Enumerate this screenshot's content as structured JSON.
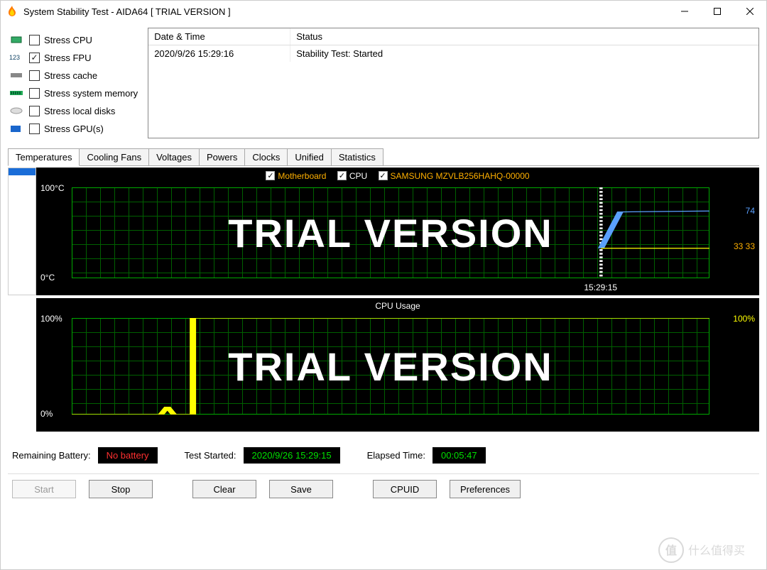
{
  "window": {
    "title": "System Stability Test - AIDA64  [ TRIAL VERSION ]"
  },
  "stress": {
    "cpu": {
      "label": "Stress CPU",
      "checked": false
    },
    "fpu": {
      "label": "Stress FPU",
      "checked": true
    },
    "cache": {
      "label": "Stress cache",
      "checked": false
    },
    "mem": {
      "label": "Stress system memory",
      "checked": false
    },
    "disk": {
      "label": "Stress local disks",
      "checked": false
    },
    "gpu": {
      "label": "Stress GPU(s)",
      "checked": false
    }
  },
  "log": {
    "header": {
      "date": "Date & Time",
      "status": "Status"
    },
    "rows": [
      {
        "date": "2020/9/26 15:29:16",
        "status": "Stability Test: Started"
      }
    ]
  },
  "tabs": {
    "temperatures": "Temperatures",
    "fans": "Cooling Fans",
    "voltages": "Voltages",
    "powers": "Powers",
    "clocks": "Clocks",
    "unified": "Unified",
    "statistics": "Statistics",
    "active": "temperatures"
  },
  "chart_data": [
    {
      "type": "line",
      "title": "Temperatures",
      "ylabel": "°C",
      "ylim": [
        0,
        100
      ],
      "axis_top": "100°C",
      "axis_bot": "0°C",
      "x_marker_label": "15:29:15",
      "x_marker_pos_pct": 83,
      "series": [
        {
          "name": "Motherboard",
          "color": "#ffb000",
          "last_value": 33,
          "right_label": "33 33"
        },
        {
          "name": "CPU",
          "color": "#5aa0ff",
          "last_value": 74,
          "right_label": "74"
        },
        {
          "name": "SAMSUNG MZVLB256HAHQ-00000",
          "color": "#ffb000",
          "last_value": 33
        }
      ],
      "watermark": "TRIAL VERSION"
    },
    {
      "type": "line",
      "title": "CPU Usage",
      "ylabel": "%",
      "ylim": [
        0,
        100
      ],
      "axis_top": "100%",
      "axis_bot": "0%",
      "series": [
        {
          "name": "CPU Usage",
          "color": "#ffff00",
          "last_value": 100,
          "right_label": "100%"
        }
      ],
      "step_pos_pct": 19,
      "watermark": "TRIAL VERSION"
    }
  ],
  "status": {
    "battery_label": "Remaining Battery:",
    "battery_value": "No battery",
    "started_label": "Test Started:",
    "started_value": "2020/9/26 15:29:15",
    "elapsed_label": "Elapsed Time:",
    "elapsed_value": "00:05:47"
  },
  "buttons": {
    "start": "Start",
    "stop": "Stop",
    "clear": "Clear",
    "save": "Save",
    "cpuid": "CPUID",
    "prefs": "Preferences"
  },
  "brand_watermark": "什么值得买"
}
